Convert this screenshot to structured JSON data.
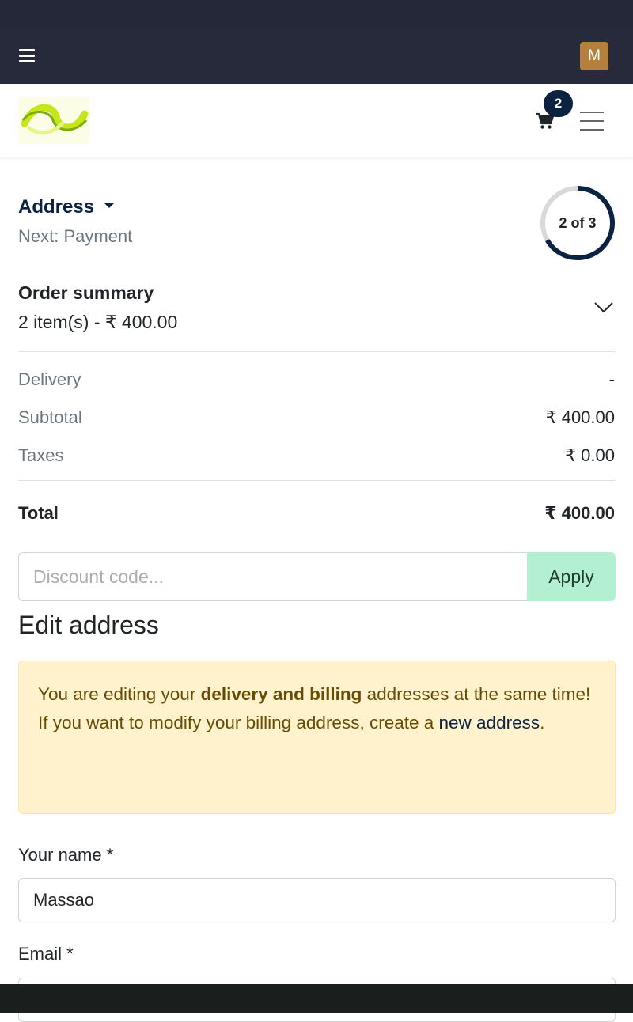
{
  "admin": {
    "avatar_letter": "M"
  },
  "header": {
    "cart_count": "2"
  },
  "checkout": {
    "step_title": "Address",
    "step_next": "Next: Payment",
    "progress_label": "2 of 3",
    "progress_fraction": 0.667
  },
  "summary": {
    "title": "Order summary",
    "items_line": "2 item(s) -  ₹ 400.00",
    "rows": [
      {
        "label": "Delivery",
        "value": "-"
      },
      {
        "label": "Subtotal",
        "value": "₹ 400.00"
      },
      {
        "label": "Taxes",
        "value": "₹ 0.00"
      }
    ],
    "total_label": "Total",
    "total_value": "₹ 400.00"
  },
  "discount": {
    "placeholder": "Discount code...",
    "apply_label": "Apply"
  },
  "edit": {
    "title": "Edit address",
    "alert_part1": "You are editing your ",
    "alert_bold": "delivery and billing",
    "alert_part2": " addresses at the same time!",
    "alert_part3": "If you want to modify your billing address, create a ",
    "alert_link": "new address",
    "alert_part4": "."
  },
  "form": {
    "name_label": "Your name *",
    "name_value": "Massao",
    "email_label": "Email *",
    "email_value": ""
  },
  "colors": {
    "primary": "#0b2340",
    "admin_bar": "#262a3b",
    "apply_bg": "#b2f0d1",
    "alert_bg": "#fff2cd"
  }
}
